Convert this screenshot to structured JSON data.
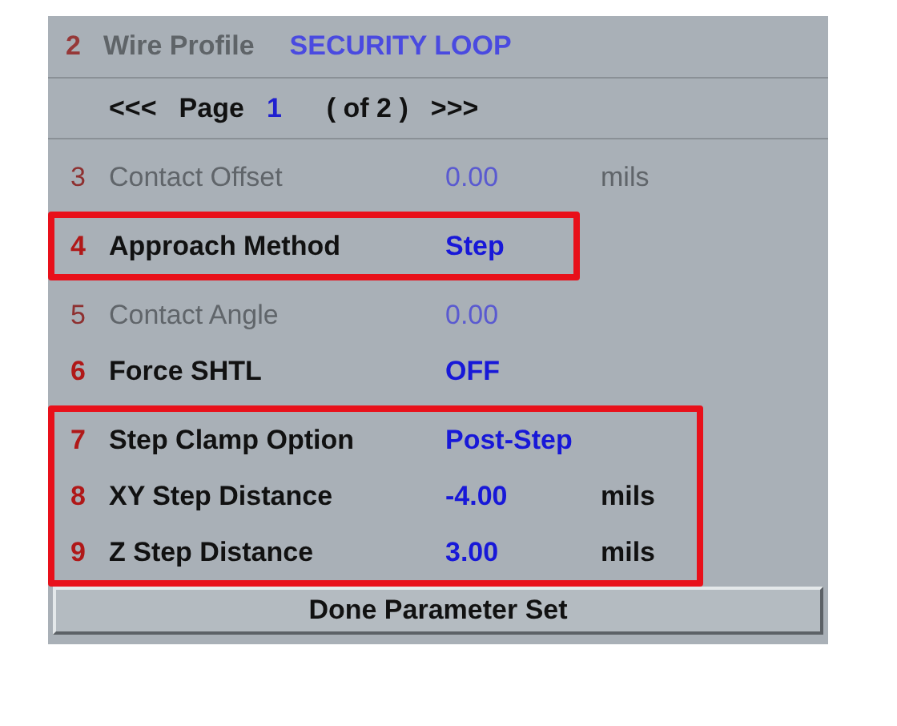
{
  "profile": {
    "number": "2",
    "label": "Wire Profile",
    "value": "SECURITY LOOP",
    "disabled": true
  },
  "pager": {
    "prev": "<<<",
    "label": "Page",
    "page": "1",
    "total": "( of 2 )",
    "next": ">>>"
  },
  "groups": [
    {
      "highlighted": false,
      "rows": [
        {
          "number": "3",
          "label": "Contact Offset",
          "value": "0.00",
          "unit": "mils",
          "disabled": true
        }
      ]
    },
    {
      "highlighted": true,
      "rows": [
        {
          "number": "4",
          "label": "Approach Method",
          "value": "Step",
          "disabled": false
        }
      ]
    },
    {
      "highlighted": false,
      "rows": [
        {
          "number": "5",
          "label": "Contact Angle",
          "value": "0.00",
          "disabled": true
        },
        {
          "number": "6",
          "label": "Force SHTL",
          "value": "OFF",
          "disabled": false
        }
      ]
    },
    {
      "highlighted": true,
      "rows": [
        {
          "number": "7",
          "label": "Step Clamp Option",
          "value": "Post-Step",
          "disabled": false
        },
        {
          "number": "8",
          "label": "XY Step Distance",
          "value": "-4.00",
          "unit": "mils",
          "disabled": false
        },
        {
          "number": "9",
          "label": "Z Step Distance",
          "value": "3.00",
          "unit": "mils",
          "disabled": false
        }
      ]
    }
  ],
  "done_button": "Done Parameter Set"
}
